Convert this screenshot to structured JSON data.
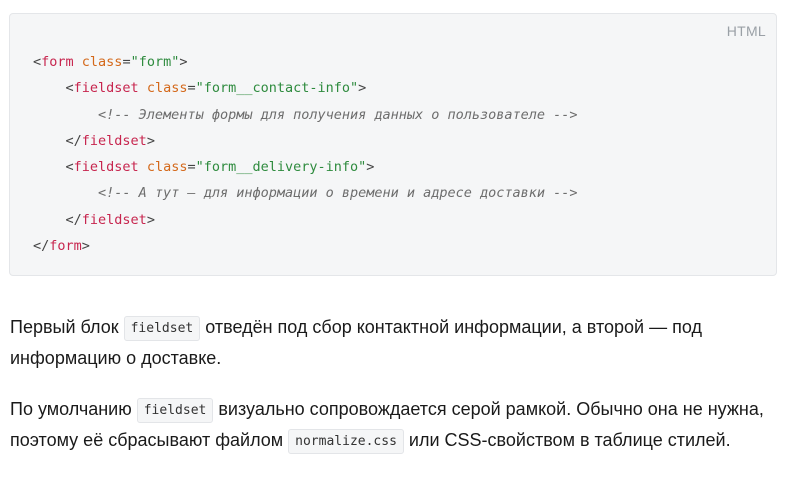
{
  "code_block": {
    "language": "HTML",
    "lines": [
      {
        "tag_open": "<",
        "tag": "form",
        "attr": "class",
        "eq": "=",
        "value": "\"form\"",
        "close": ">"
      },
      {
        "tag_open": "<",
        "tag": "fieldset",
        "attr": "class",
        "eq": "=",
        "value": "\"form__contact-info\"",
        "close": ">"
      },
      {
        "comment": "<!-- Элементы формы для получения данных о пользователе -->"
      },
      {
        "tag_open": "</",
        "tag": "fieldset",
        "close": ">"
      },
      {
        "tag_open": "<",
        "tag": "fieldset",
        "attr": "class",
        "eq": "=",
        "value": "\"form__delivery-info\"",
        "close": ">"
      },
      {
        "comment": "<!-- А тут — для информации о времени и адресе доставки -->"
      },
      {
        "tag_open": "</",
        "tag": "fieldset",
        "close": ">"
      },
      {
        "tag_open": "</",
        "tag": "form",
        "close": ">"
      }
    ]
  },
  "paragraphs": {
    "p1": {
      "before": "Первый блок ",
      "code": "fieldset",
      "after": " отведён под сбор контактной информации, а второй — под информацию о доставке."
    },
    "p2": {
      "before": "По умолчанию ",
      "code1": "fieldset",
      "middle": " визуально сопровождается серой рамкой. Обычно она не нужна, поэтому её сбрасывают файлом ",
      "code2": "normalize.css",
      "after": " или CSS-свойством в таблице стилей."
    }
  }
}
